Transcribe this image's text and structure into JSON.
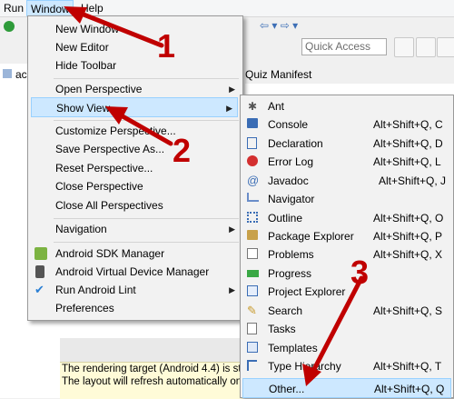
{
  "menubar": {
    "run": "Run",
    "window": "Window",
    "help": "Help"
  },
  "toolbar": {
    "quick_access_placeholder": "Quick Access"
  },
  "background": {
    "left_tab": "ac",
    "editor_tab": "Quiz Manifest",
    "message_line1": "The rendering target (Android 4.4) is stil",
    "message_line2": "The layout will refresh automatically onc"
  },
  "window_menu": {
    "items": [
      {
        "label": "New Window"
      },
      {
        "label": "New Editor"
      },
      {
        "label": "Hide Toolbar"
      },
      {
        "label": "Open Perspective"
      },
      {
        "label": "Show View"
      },
      {
        "label": "Customize Perspective..."
      },
      {
        "label": "Save Perspective As..."
      },
      {
        "label": "Reset Perspective..."
      },
      {
        "label": "Close Perspective"
      },
      {
        "label": "Close All Perspectives"
      },
      {
        "label": "Navigation"
      },
      {
        "label": "Android SDK Manager"
      },
      {
        "label": "Android Virtual Device Manager"
      },
      {
        "label": "Run Android Lint"
      },
      {
        "label": "Preferences"
      }
    ]
  },
  "show_view_menu": {
    "items": [
      {
        "label": "Ant",
        "shortcut": ""
      },
      {
        "label": "Console",
        "shortcut": "Alt+Shift+Q, C"
      },
      {
        "label": "Declaration",
        "shortcut": "Alt+Shift+Q, D"
      },
      {
        "label": "Error Log",
        "shortcut": "Alt+Shift+Q, L"
      },
      {
        "label": "Javadoc",
        "shortcut": "Alt+Shift+Q, J"
      },
      {
        "label": "Navigator",
        "shortcut": ""
      },
      {
        "label": "Outline",
        "shortcut": "Alt+Shift+Q, O"
      },
      {
        "label": "Package Explorer",
        "shortcut": "Alt+Shift+Q, P"
      },
      {
        "label": "Problems",
        "shortcut": "Alt+Shift+Q, X"
      },
      {
        "label": "Progress",
        "shortcut": ""
      },
      {
        "label": "Project Explorer",
        "shortcut": ""
      },
      {
        "label": "Search",
        "shortcut": "Alt+Shift+Q, S"
      },
      {
        "label": "Tasks",
        "shortcut": ""
      },
      {
        "label": "Templates",
        "shortcut": ""
      },
      {
        "label": "Type Hierarchy",
        "shortcut": "Alt+Shift+Q, T"
      },
      {
        "label": "Other...",
        "shortcut": "Alt+Shift+Q, Q"
      }
    ]
  },
  "annotations": {
    "step1": "1",
    "step2": "2",
    "step3": "3",
    "color": "#c00000"
  },
  "colors": {
    "highlight": "#cde8ff",
    "highlight_border": "#99d1ff",
    "menu_bg": "#f2f2f2"
  }
}
